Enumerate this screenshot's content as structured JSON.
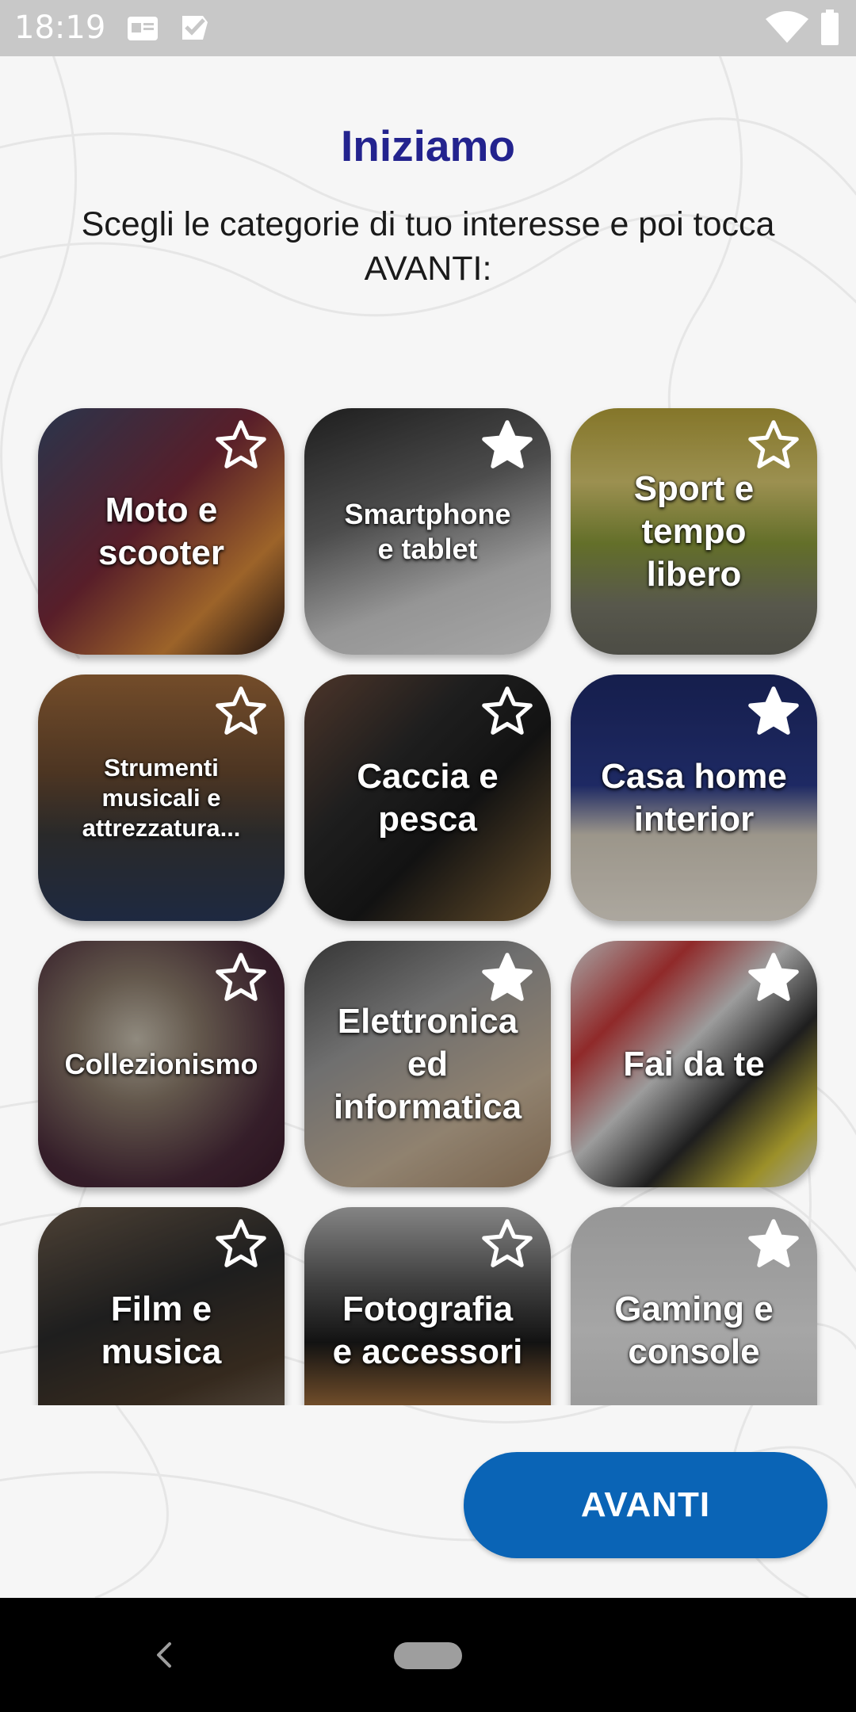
{
  "status_bar": {
    "time": "18:19",
    "icons": [
      "notification-card-icon",
      "check-badge-icon",
      "wifi-icon",
      "battery-icon"
    ]
  },
  "page": {
    "title": "Iniziamo",
    "subtitle": "Scegli le categorie di tuo interesse e poi tocca AVANTI:"
  },
  "categories": [
    {
      "label": "Moto e\nscooter",
      "favorite": false
    },
    {
      "label": "Smartphone\ne tablet",
      "favorite": true
    },
    {
      "label": "Sport e\ntempo\nlibero",
      "favorite": false
    },
    {
      "label": "Strumenti\nmusicali e\nattrezzatura...",
      "favorite": false
    },
    {
      "label": "Caccia e\npesca",
      "favorite": false
    },
    {
      "label": "Casa home\ninterior",
      "favorite": true
    },
    {
      "label": "Collezionismo",
      "favorite": false
    },
    {
      "label": "Elettronica\ned\ninformatica",
      "favorite": true
    },
    {
      "label": "Fai da te",
      "favorite": true
    },
    {
      "label": "Film e\nmusica",
      "favorite": false
    },
    {
      "label": "Fotografia\ne accessori",
      "favorite": false
    },
    {
      "label": "Gaming e\nconsole",
      "favorite": true
    }
  ],
  "actions": {
    "next_label": "AVANTI"
  },
  "colors": {
    "title": "#23238e",
    "button": "#0a64b6",
    "status_bar": "#c8c8c8",
    "nav_bar": "#000000"
  }
}
